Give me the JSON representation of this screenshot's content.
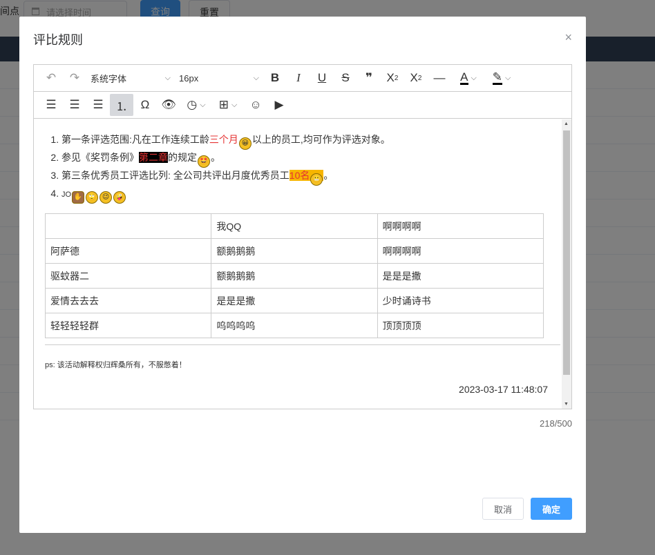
{
  "background": {
    "label": "间点",
    "date_placeholder": "请选择时间",
    "query_button": "查询",
    "reset_button": "重置"
  },
  "dialog": {
    "title": "评比规则",
    "close_icon": "×",
    "toolbar": {
      "font_family": "系统字体",
      "font_size": "16px"
    },
    "content": {
      "items": [
        {
          "a": "第一条评选范围:凡在工作连续工龄",
          "red": "三个月",
          "b": "以上的员工,均可作为评选对象。"
        },
        {
          "a": "参见《奖罚条例》",
          "hl": "第二章",
          "b": "的规定",
          "c": "。"
        },
        {
          "a": "第三条优秀员工评选比列: 全公司共评出月度优秀员工",
          "hl": "10名",
          "c": "。"
        },
        {
          "a": "JO"
        }
      ],
      "table": [
        [
          "",
          "我QQ",
          "啊啊啊啊"
        ],
        [
          "阿萨德",
          " 额鹅鹅鹅",
          "啊啊啊啊"
        ],
        [
          "驱蚊器二",
          "额鹅鹅鹅",
          "是是是撒"
        ],
        [
          "爱情去去去",
          "是是是撒",
          "少时诵诗书"
        ],
        [
          "轻轻轻轻群",
          "呜呜呜呜",
          "顶顶顶顶"
        ]
      ],
      "ps": "ps: 该活动解释权归辉桑所有，不服憋着！",
      "date": "2023-03-17 11:48:07"
    },
    "char_count": "218/500",
    "cancel_button": "取消",
    "confirm_button": "确定"
  }
}
